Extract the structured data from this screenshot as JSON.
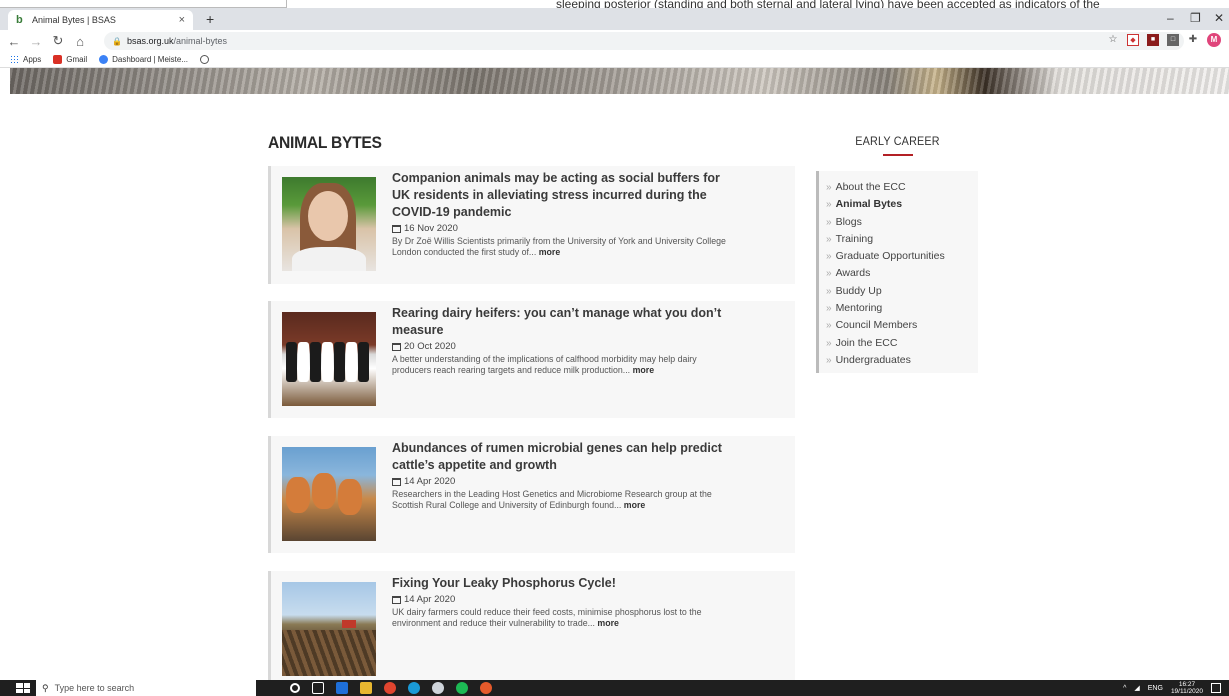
{
  "overlay": {
    "snippet": "sleeping posterior (standing and both sternal and lateral lying) have been accepted as indicators of the"
  },
  "browser": {
    "tab_title": "Animal Bytes | BSAS",
    "tab_close": "×",
    "new_tab": "+",
    "window_controls": {
      "minimize": "–",
      "maximize": "❐",
      "close": "✕"
    },
    "url_host": "bsas.org.uk",
    "url_path": "/animal-bytes",
    "bookmarks": [
      {
        "label": "Apps"
      },
      {
        "label": "Gmail"
      },
      {
        "label": "Dashboard | Meiste..."
      }
    ],
    "avatar_letter": "M",
    "accent_color": "#1a73e8"
  },
  "main": {
    "page_title": "ANIMAL BYTES",
    "more_label": "more",
    "articles": [
      {
        "title": "Companion animals may be acting as social buffers for UK residents in alleviating stress incurred during the COVID-19 pandemic",
        "date": "16 Nov 2020",
        "excerpt": "By Dr Zoë Willis Scientists primarily from the University of York and University College London conducted the first study of..."
      },
      {
        "title": "Rearing dairy heifers: you can’t manage what you don’t measure",
        "date": "20 Oct 2020",
        "excerpt": "A better understanding of the implications of calfhood morbidity may help dairy producers reach rearing targets and reduce milk production..."
      },
      {
        "title": "Abundances of rumen microbial genes can help predict cattle’s appetite and growth",
        "date": "14 Apr 2020",
        "excerpt": "Researchers in the Leading Host Genetics and Microbiome Research group at the Scottish Rural College and University of Edinburgh found..."
      },
      {
        "title": "Fixing Your Leaky Phosphorus Cycle!",
        "date": "14 Apr 2020",
        "excerpt": "UK dairy farmers could reduce their feed costs, minimise phosphorus lost to the environment and reduce their vulnerability to trade..."
      }
    ]
  },
  "sidebar": {
    "title": "EARLY CAREER",
    "accent_color": "#b32025",
    "chevron": "»",
    "items": [
      {
        "label": "About the ECC",
        "active": false
      },
      {
        "label": "Animal Bytes",
        "active": true
      },
      {
        "label": "Blogs",
        "active": false
      },
      {
        "label": "Training",
        "active": false
      },
      {
        "label": "Graduate Opportunities",
        "active": false
      },
      {
        "label": "Awards",
        "active": false
      },
      {
        "label": "Buddy Up",
        "active": false
      },
      {
        "label": "Mentoring",
        "active": false
      },
      {
        "label": "Council Members",
        "active": false
      },
      {
        "label": "Join the ECC",
        "active": false
      },
      {
        "label": "Undergraduates",
        "active": false
      }
    ]
  },
  "taskbar": {
    "search_placeholder": "Type here to search",
    "language": "ENG",
    "time": "16:27",
    "date": "19/11/2020"
  }
}
